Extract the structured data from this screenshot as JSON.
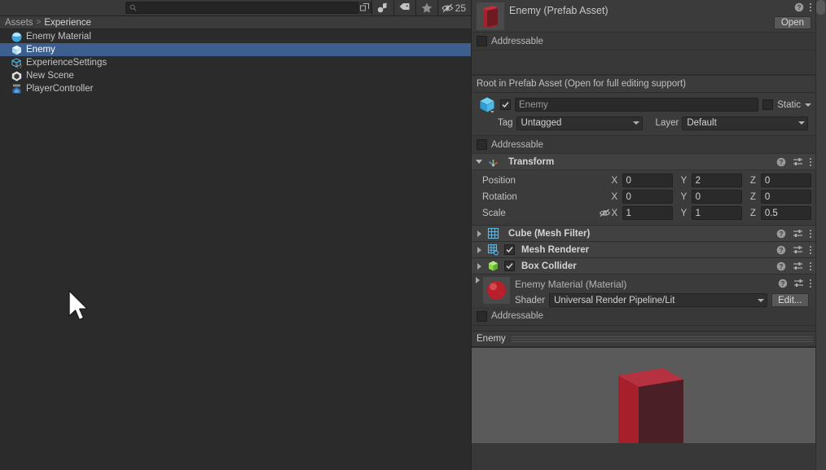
{
  "project": {
    "toolbar": {
      "search_value": "",
      "search_placeholder": "",
      "search_icon": "search-icon",
      "expand_icon": "expand-window-icon",
      "filter_type_icon": "filter-by-type-icon",
      "filter_label_icon": "filter-by-label-icon",
      "favorites_icon": "favorites-star-icon",
      "hidden_icon": "hidden-objects-icon",
      "hidden_count": "25"
    },
    "breadcrumb": {
      "root": "Assets",
      "separator": ">",
      "current": "Experience"
    },
    "assets": [
      {
        "name": "Enemy Material",
        "icon": "material-sphere-icon",
        "selected": false
      },
      {
        "name": "Enemy",
        "icon": "prefab-cube-icon",
        "selected": true
      },
      {
        "name": "ExperienceSettings",
        "icon": "scriptable-object-icon",
        "selected": false
      },
      {
        "name": "New Scene",
        "icon": "unity-scene-icon",
        "selected": false
      },
      {
        "name": "PlayerController",
        "icon": "csharp-script-icon",
        "selected": false
      }
    ]
  },
  "inspector": {
    "asset_header": {
      "title": "Enemy (Prefab Asset)",
      "thumb_icon": "red-cube-preview",
      "help_icon": "help-icon",
      "menu_icon": "more-menu-icon",
      "open_label": "Open"
    },
    "addressable_asset": {
      "label": "Addressable",
      "checked": false
    },
    "root_note": "Root in Prefab Asset (Open for full editing support)",
    "game_object": {
      "icon": "gameobject-cube-icon",
      "enabled": true,
      "name_value": "Enemy",
      "static_label": "Static",
      "static_checked": false,
      "static_dropdown_icon": "chevron-down-icon",
      "tag_label": "Tag",
      "tag_value": "Untagged",
      "layer_label": "Layer",
      "layer_value": "Default"
    },
    "addressable_go": {
      "label": "Addressable",
      "checked": false
    },
    "transform": {
      "title": "Transform",
      "icon": "transform-axis-icon",
      "expanded": true,
      "help_icon": "help-icon",
      "preset_icon": "preset-icon",
      "menu_icon": "more-menu-icon",
      "rows": [
        {
          "label": "Position",
          "x": "0",
          "y": "2",
          "z": "0",
          "link": false
        },
        {
          "label": "Rotation",
          "x": "0",
          "y": "0",
          "z": "0",
          "link": false
        },
        {
          "label": "Scale",
          "x": "1",
          "y": "1",
          "z": "0.5",
          "link": true,
          "link_icon": "scale-unlinked-icon"
        }
      ],
      "axis_x": "X",
      "axis_y": "Y",
      "axis_z": "Z"
    },
    "components": [
      {
        "title": "Cube (Mesh Filter)",
        "icon": "mesh-filter-icon",
        "has_toggle": false,
        "checked": false,
        "expanded": false
      },
      {
        "title": "Mesh Renderer",
        "icon": "mesh-renderer-icon",
        "has_toggle": true,
        "checked": true,
        "expanded": false
      },
      {
        "title": "Box Collider",
        "icon": "box-collider-icon",
        "has_toggle": true,
        "checked": true,
        "expanded": false
      }
    ],
    "material": {
      "name": "Enemy Material (Material)",
      "thumb_icon": "red-sphere-preview",
      "shader_label": "Shader",
      "shader_value": "Universal Render Pipeline/Lit",
      "edit_label": "Edit...",
      "help_icon": "help-icon",
      "preset_icon": "preset-icon",
      "menu_icon": "more-menu-icon",
      "addressable_label": "Addressable",
      "addressable_checked": false
    },
    "preview": {
      "title": "Enemy",
      "menu_icon": "more-menu-icon",
      "object_icon": "red-box-3d"
    }
  },
  "colors": {
    "panel_bg": "#2b2b2b",
    "inspector_bg": "#383838",
    "component_header": "#414141",
    "selection_blue": "#3d5f8f",
    "enemy_red": "#a61f2b",
    "preview_bg": "#5a5a5a",
    "accent_cyan": "#4ec3f0"
  }
}
